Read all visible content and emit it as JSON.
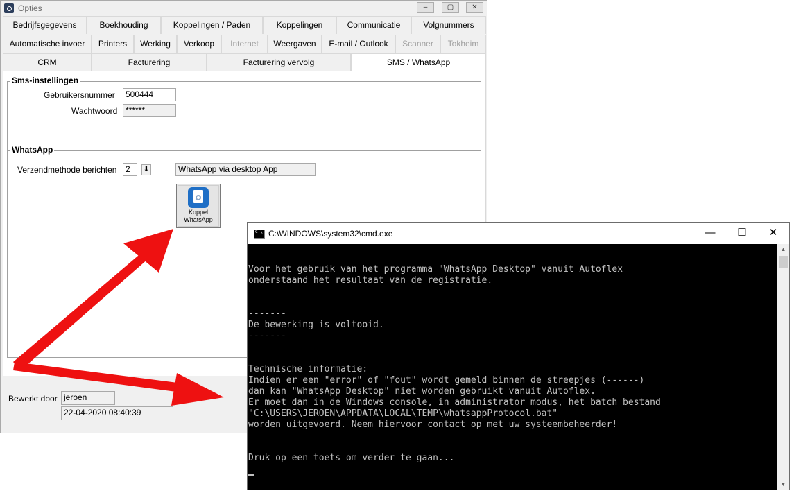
{
  "opties": {
    "title": "Opties",
    "tabs_row1": [
      "Bedrijfsgegevens",
      "Boekhouding",
      "Koppelingen / Paden",
      "Koppelingen",
      "Communicatie",
      "Volgnummers"
    ],
    "tabs_row2": [
      "Automatische invoer",
      "Printers",
      "Werking",
      "Verkoop",
      "Internet",
      "Weergaven",
      "E-mail / Outlook",
      "Scanner",
      "Tokheim"
    ],
    "tabs_row3": [
      "CRM",
      "Facturering",
      "Facturering vervolg",
      "SMS / WhatsApp"
    ],
    "sms": {
      "section_title": "Sms-instellingen",
      "user_label": "Gebruikersnummer",
      "user_value": "500444",
      "password_label": "Wachtwoord",
      "password_value": "******"
    },
    "whatsapp": {
      "section_title": "WhatsApp",
      "method_label": "Verzendmethode berichten",
      "method_value": "2",
      "method_desc": "WhatsApp via desktop App",
      "koppel_button_label": "Koppel\nWhatsApp"
    },
    "footer": {
      "edited_by_label": "Bewerkt door",
      "edited_by_value": "jeroen",
      "edited_date": "22-04-2020 08:40:39"
    }
  },
  "cmd": {
    "title": "C:\\WINDOWS\\system32\\cmd.exe",
    "text": "Voor het gebruik van het programma \"WhatsApp Desktop\" vanuit Autoflex\nonderstaand het resultaat van de registratie.\n\n\n-------\nDe bewerking is voltooid.\n-------\n\n\nTechnische informatie:\nIndien er een \"error\" of \"fout\" wordt gemeld binnen de streepjes (------)\ndan kan \"WhatsApp Desktop\" niet worden gebruikt vanuit Autoflex.\nEr moet dan in de Windows console, in administrator modus, het batch bestand\n\"C:\\USERS\\JEROEN\\APPDATA\\LOCAL\\TEMP\\whatsappProtocol.bat\"\nworden uitgevoerd. Neem hiervoor contact op met uw systeembeheerder!\n\n\nDruk op een toets om verder te gaan..."
  },
  "colors": {
    "arrow": "#ee1111",
    "cmd_bg": "#000000",
    "cmd_text": "#c0c0c0"
  }
}
